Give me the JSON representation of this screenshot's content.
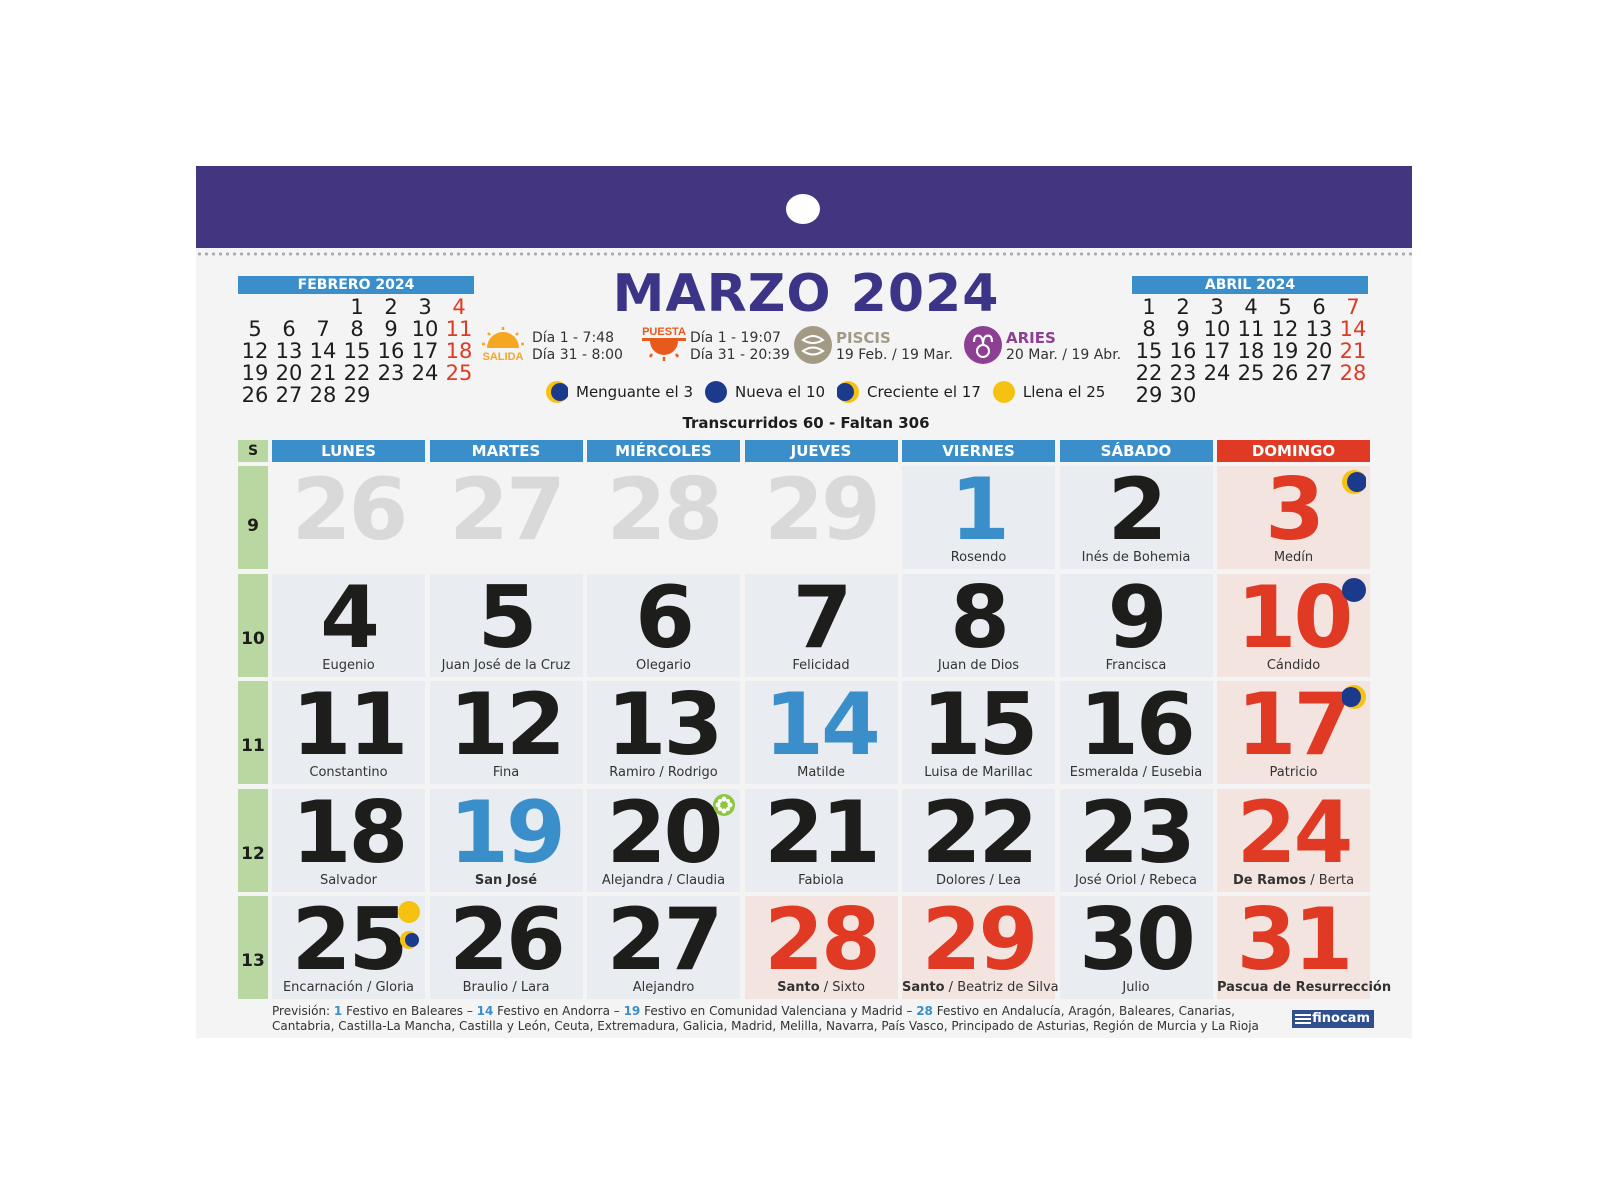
{
  "title": "MARZO 2024",
  "colors": {
    "purple": "#443581",
    "blue": "#3a8fcb",
    "red": "#e03a24",
    "green": "#b9d7a1",
    "yellow": "#f5c211",
    "navy": "#1c3a8c"
  },
  "mini_prev": {
    "title": "FEBRERO 2024",
    "rows": [
      [
        "",
        "",
        "",
        "1",
        "2",
        "3",
        "4"
      ],
      [
        "5",
        "6",
        "7",
        "8",
        "9",
        "10",
        "11"
      ],
      [
        "12",
        "13",
        "14",
        "15",
        "16",
        "17",
        "18"
      ],
      [
        "19",
        "20",
        "21",
        "22",
        "23",
        "24",
        "25"
      ],
      [
        "26",
        "27",
        "28",
        "29",
        "",
        "",
        ""
      ]
    ]
  },
  "mini_next": {
    "title": "ABRIL 2024",
    "rows": [
      [
        "1",
        "2",
        "3",
        "4",
        "5",
        "6",
        "7"
      ],
      [
        "8",
        "9",
        "10",
        "11",
        "12",
        "13",
        "14"
      ],
      [
        "15",
        "16",
        "17",
        "18",
        "19",
        "20",
        "21"
      ],
      [
        "22",
        "23",
        "24",
        "25",
        "26",
        "27",
        "28"
      ],
      [
        "29",
        "30",
        "",
        "",
        "",
        "",
        ""
      ]
    ]
  },
  "sunrise": {
    "label": "SALIDA",
    "line1": "Día 1 - 7:48",
    "line2": "Día 31 - 8:00",
    "icon": "sunrise-icon"
  },
  "sunset": {
    "label": "PUESTA",
    "line1": "Día 1 - 19:07",
    "line2": "Día 31 - 20:39",
    "icon": "sunset-icon"
  },
  "zodiac1": {
    "name": "PISCIS",
    "dates": "19 Feb. / 19 Mar.",
    "icon": "pisces-icon"
  },
  "zodiac2": {
    "name": "ARIES",
    "dates": "20 Mar. / 19 Abr.",
    "icon": "aries-icon"
  },
  "moons": [
    {
      "text": "Menguante el 3",
      "icon": "waning-moon-icon"
    },
    {
      "text": "Nueva el 10",
      "icon": "new-moon-icon"
    },
    {
      "text": "Creciente el 17",
      "icon": "waxing-moon-icon"
    },
    {
      "text": "Llena el 25",
      "icon": "full-moon-icon"
    }
  ],
  "elapsed": "Transcurridos 60 - Faltan 306",
  "week_header": "S",
  "weeks": [
    "9",
    "10",
    "11",
    "12",
    "13"
  ],
  "days_of_week": [
    "LUNES",
    "MARTES",
    "MIÉRCOLES",
    "JUEVES",
    "VIERNES",
    "SÁBADO",
    "DOMINGO"
  ],
  "cells": [
    [
      {
        "n": "26",
        "s": "",
        "st": "grey"
      },
      {
        "n": "27",
        "s": "",
        "st": "grey"
      },
      {
        "n": "28",
        "s": "",
        "st": "grey"
      },
      {
        "n": "29",
        "s": "",
        "st": "grey"
      },
      {
        "n": "1",
        "s": "Rosendo",
        "st": "blue"
      },
      {
        "n": "2",
        "s": "Inés de Bohemia",
        "st": ""
      },
      {
        "n": "3",
        "s": "Medín",
        "st": "red",
        "moon": "waning"
      }
    ],
    [
      {
        "n": "4",
        "s": "Eugenio"
      },
      {
        "n": "5",
        "s": "Juan José de la Cruz"
      },
      {
        "n": "6",
        "s": "Olegario"
      },
      {
        "n": "7",
        "s": "Felicidad"
      },
      {
        "n": "8",
        "s": "Juan de Dios"
      },
      {
        "n": "9",
        "s": "Francisca"
      },
      {
        "n": "10",
        "s": "Cándido",
        "st": "red",
        "moon": "new"
      }
    ],
    [
      {
        "n": "11",
        "s": "Constantino"
      },
      {
        "n": "12",
        "s": "Fina"
      },
      {
        "n": "13",
        "s": "Ramiro / Rodrigo"
      },
      {
        "n": "14",
        "s": "Matilde",
        "st": "blue"
      },
      {
        "n": "15",
        "s": "Luisa de Marillac"
      },
      {
        "n": "16",
        "s": "Esmeralda / Eusebia"
      },
      {
        "n": "17",
        "s": "Patricio",
        "st": "red",
        "moon": "waxing"
      }
    ],
    [
      {
        "n": "18",
        "s": "Salvador"
      },
      {
        "n": "19",
        "s": "San José",
        "st": "blue",
        "bold": "San José",
        "rest": ""
      },
      {
        "n": "20",
        "s": "Alejandra / Claudia",
        "moon": "spring"
      },
      {
        "n": "21",
        "s": "Fabiola"
      },
      {
        "n": "22",
        "s": "Dolores / Lea"
      },
      {
        "n": "23",
        "s": "José Oriol / Rebeca"
      },
      {
        "n": "24",
        "s": "De Ramos / Berta",
        "st": "red",
        "bold": "De Ramos",
        "rest": " / Berta"
      }
    ],
    [
      {
        "n": "25",
        "s": "Encarnación / Gloria",
        "moon": "full"
      },
      {
        "n": "26",
        "s": "Braulio / Lara"
      },
      {
        "n": "27",
        "s": "Alejandro"
      },
      {
        "n": "28",
        "s": "Santo / Sixto",
        "st": "red",
        "bold": "Santo",
        "rest": " / Sixto",
        "bg": "sun"
      },
      {
        "n": "29",
        "s": "Santo / Beatriz de Silva",
        "st": "red",
        "bold": "Santo",
        "rest": " / Beatriz de Silva",
        "bg": "sun"
      },
      {
        "n": "30",
        "s": "Julio"
      },
      {
        "n": "31",
        "s": "Pascua de Resurrección",
        "st": "red",
        "bold": "Pascua de Resurrección",
        "rest": ""
      }
    ]
  ],
  "footer": {
    "p0": "Previsión: ",
    "d1": "1",
    "p1": " Festivo en Baleares – ",
    "d2": "14",
    "p2": " Festivo en Andorra – ",
    "d3": "19",
    "p3": " Festivo en Comunidad Valenciana y Madrid – ",
    "d4": "28",
    "p4": " Festivo en Andalucía, Aragón, Baleares, Canarias, Cantabria, Castilla-La Mancha, Castilla y León, Ceuta, Extremadura, Galicia, Madrid, Melilla, Navarra, País Vasco, Principado de Asturias, Región de Murcia y La Rioja"
  },
  "brand": "finocam"
}
